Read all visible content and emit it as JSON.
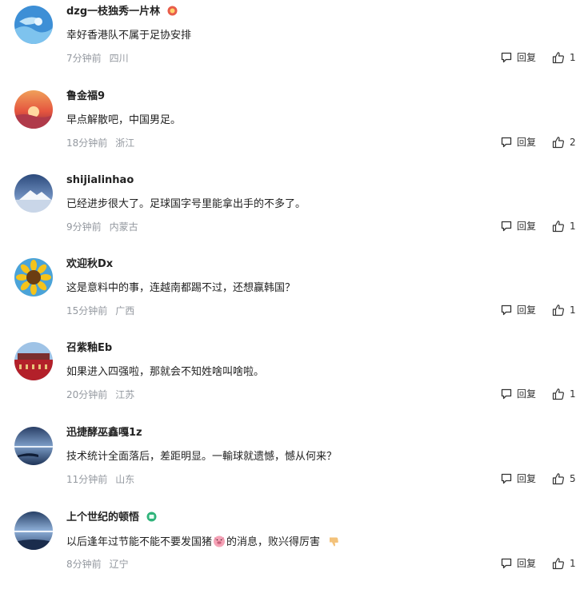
{
  "labels": {
    "reply": "回复"
  },
  "comments": [
    {
      "username": "dzg一枝独秀一片林",
      "badge": "medal-badge-icon",
      "text": "幸好香港队不属于足协安排",
      "time": "7分钟前",
      "location": "四川",
      "likes": "1"
    },
    {
      "username": "鲁金福9",
      "text": "早点解散吧，中国男足。",
      "time": "18分钟前",
      "location": "浙江",
      "likes": "2"
    },
    {
      "username": "shijialinhao",
      "text": "已经进步很大了。足球国字号里能拿出手的不多了。",
      "time": "9分钟前",
      "location": "内蒙古",
      "likes": "1"
    },
    {
      "username": "欢迎秋Dx",
      "text": "这是意料中的事，连越南都踢不过，还想赢韩国？",
      "time": "15分钟前",
      "location": "广西",
      "likes": "1"
    },
    {
      "username": "召紫釉Eb",
      "text": "如果进入四强啦，那就会不知姓啥叫啥啦。",
      "time": "20分钟前",
      "location": "江苏",
      "likes": "1"
    },
    {
      "username": "迅捷酵巫鑫嘎1z",
      "text": "技术统计全面落后，差距明显。一輸球就遗憾，憾从何来？",
      "time": "11分钟前",
      "location": "山东",
      "likes": "5"
    },
    {
      "username": "上个世纪的顿悟",
      "badge": "level-badge-icon",
      "text_before": "以后逢年过节能不能不要发国猪",
      "text_after": "的消息，败兴得厉害",
      "time": "8分钟前",
      "location": "辽宁",
      "likes": "1"
    }
  ]
}
